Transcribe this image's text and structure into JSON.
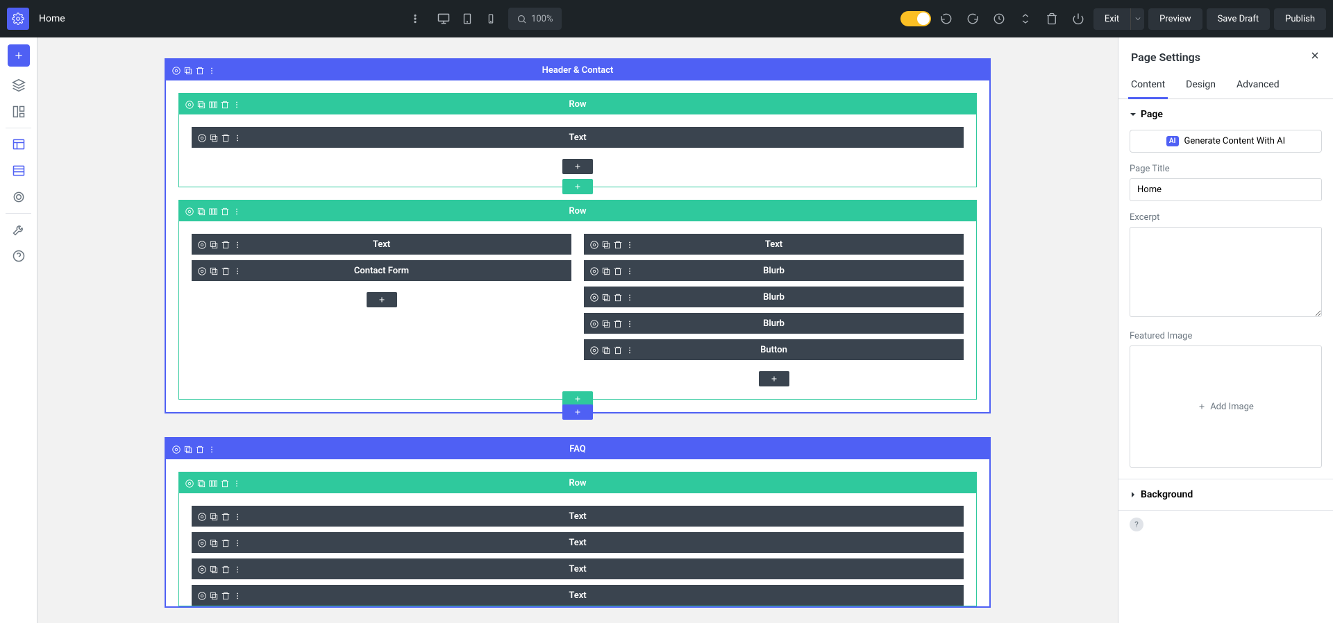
{
  "topbar": {
    "title": "Home",
    "zoom": "100%",
    "exit": "Exit",
    "preview": "Preview",
    "save_draft": "Save Draft",
    "publish": "Publish",
    "dots_icon": "dots",
    "device_desktop": "desktop",
    "device_tablet": "tablet",
    "device_mobile": "mobile",
    "search_icon": "search",
    "theme_toggle": "theme-toggle",
    "undo_icon": "undo",
    "redo_icon": "redo",
    "history_icon": "history",
    "arrows_icon": "arrows",
    "trash_icon": "trash",
    "power_icon": "power",
    "home_gear_icon": "gear"
  },
  "leftsb": {
    "add": "plus",
    "layers": "layers",
    "panels": "panels",
    "wireframe1": "wireframe",
    "wireframe2": "wireframe",
    "grid": "grid",
    "tools": "tools",
    "help": "help"
  },
  "canvas": {
    "sections": [
      {
        "label": "Header & Contact",
        "rows": [
          {
            "label": "Row",
            "cols": [
              {
                "modules": [
                  {
                    "label": "Text"
                  }
                ]
              }
            ]
          },
          {
            "label": "Row",
            "cols": [
              {
                "modules": [
                  {
                    "label": "Text"
                  },
                  {
                    "label": "Contact Form"
                  }
                ]
              },
              {
                "modules": [
                  {
                    "label": "Text"
                  },
                  {
                    "label": "Blurb"
                  },
                  {
                    "label": "Blurb"
                  },
                  {
                    "label": "Blurb"
                  },
                  {
                    "label": "Button"
                  }
                ]
              }
            ]
          }
        ]
      },
      {
        "label": "FAQ",
        "rows": [
          {
            "label": "Row",
            "cols": [
              {
                "modules": [
                  {
                    "label": "Text"
                  },
                  {
                    "label": "Text"
                  },
                  {
                    "label": "Text"
                  },
                  {
                    "label": "Text"
                  }
                ]
              }
            ]
          }
        ]
      }
    ]
  },
  "rpanel": {
    "title": "Page Settings",
    "tabs": {
      "content": "Content",
      "design": "Design",
      "advanced": "Advanced"
    },
    "acc_page": "Page",
    "ai_label": "Generate Content With AI",
    "page_title_label": "Page Title",
    "page_title_value": "Home",
    "excerpt_label": "Excerpt",
    "excerpt_value": "",
    "featured_label": "Featured Image",
    "add_image": "Add Image",
    "acc_background": "Background",
    "help": "?"
  }
}
